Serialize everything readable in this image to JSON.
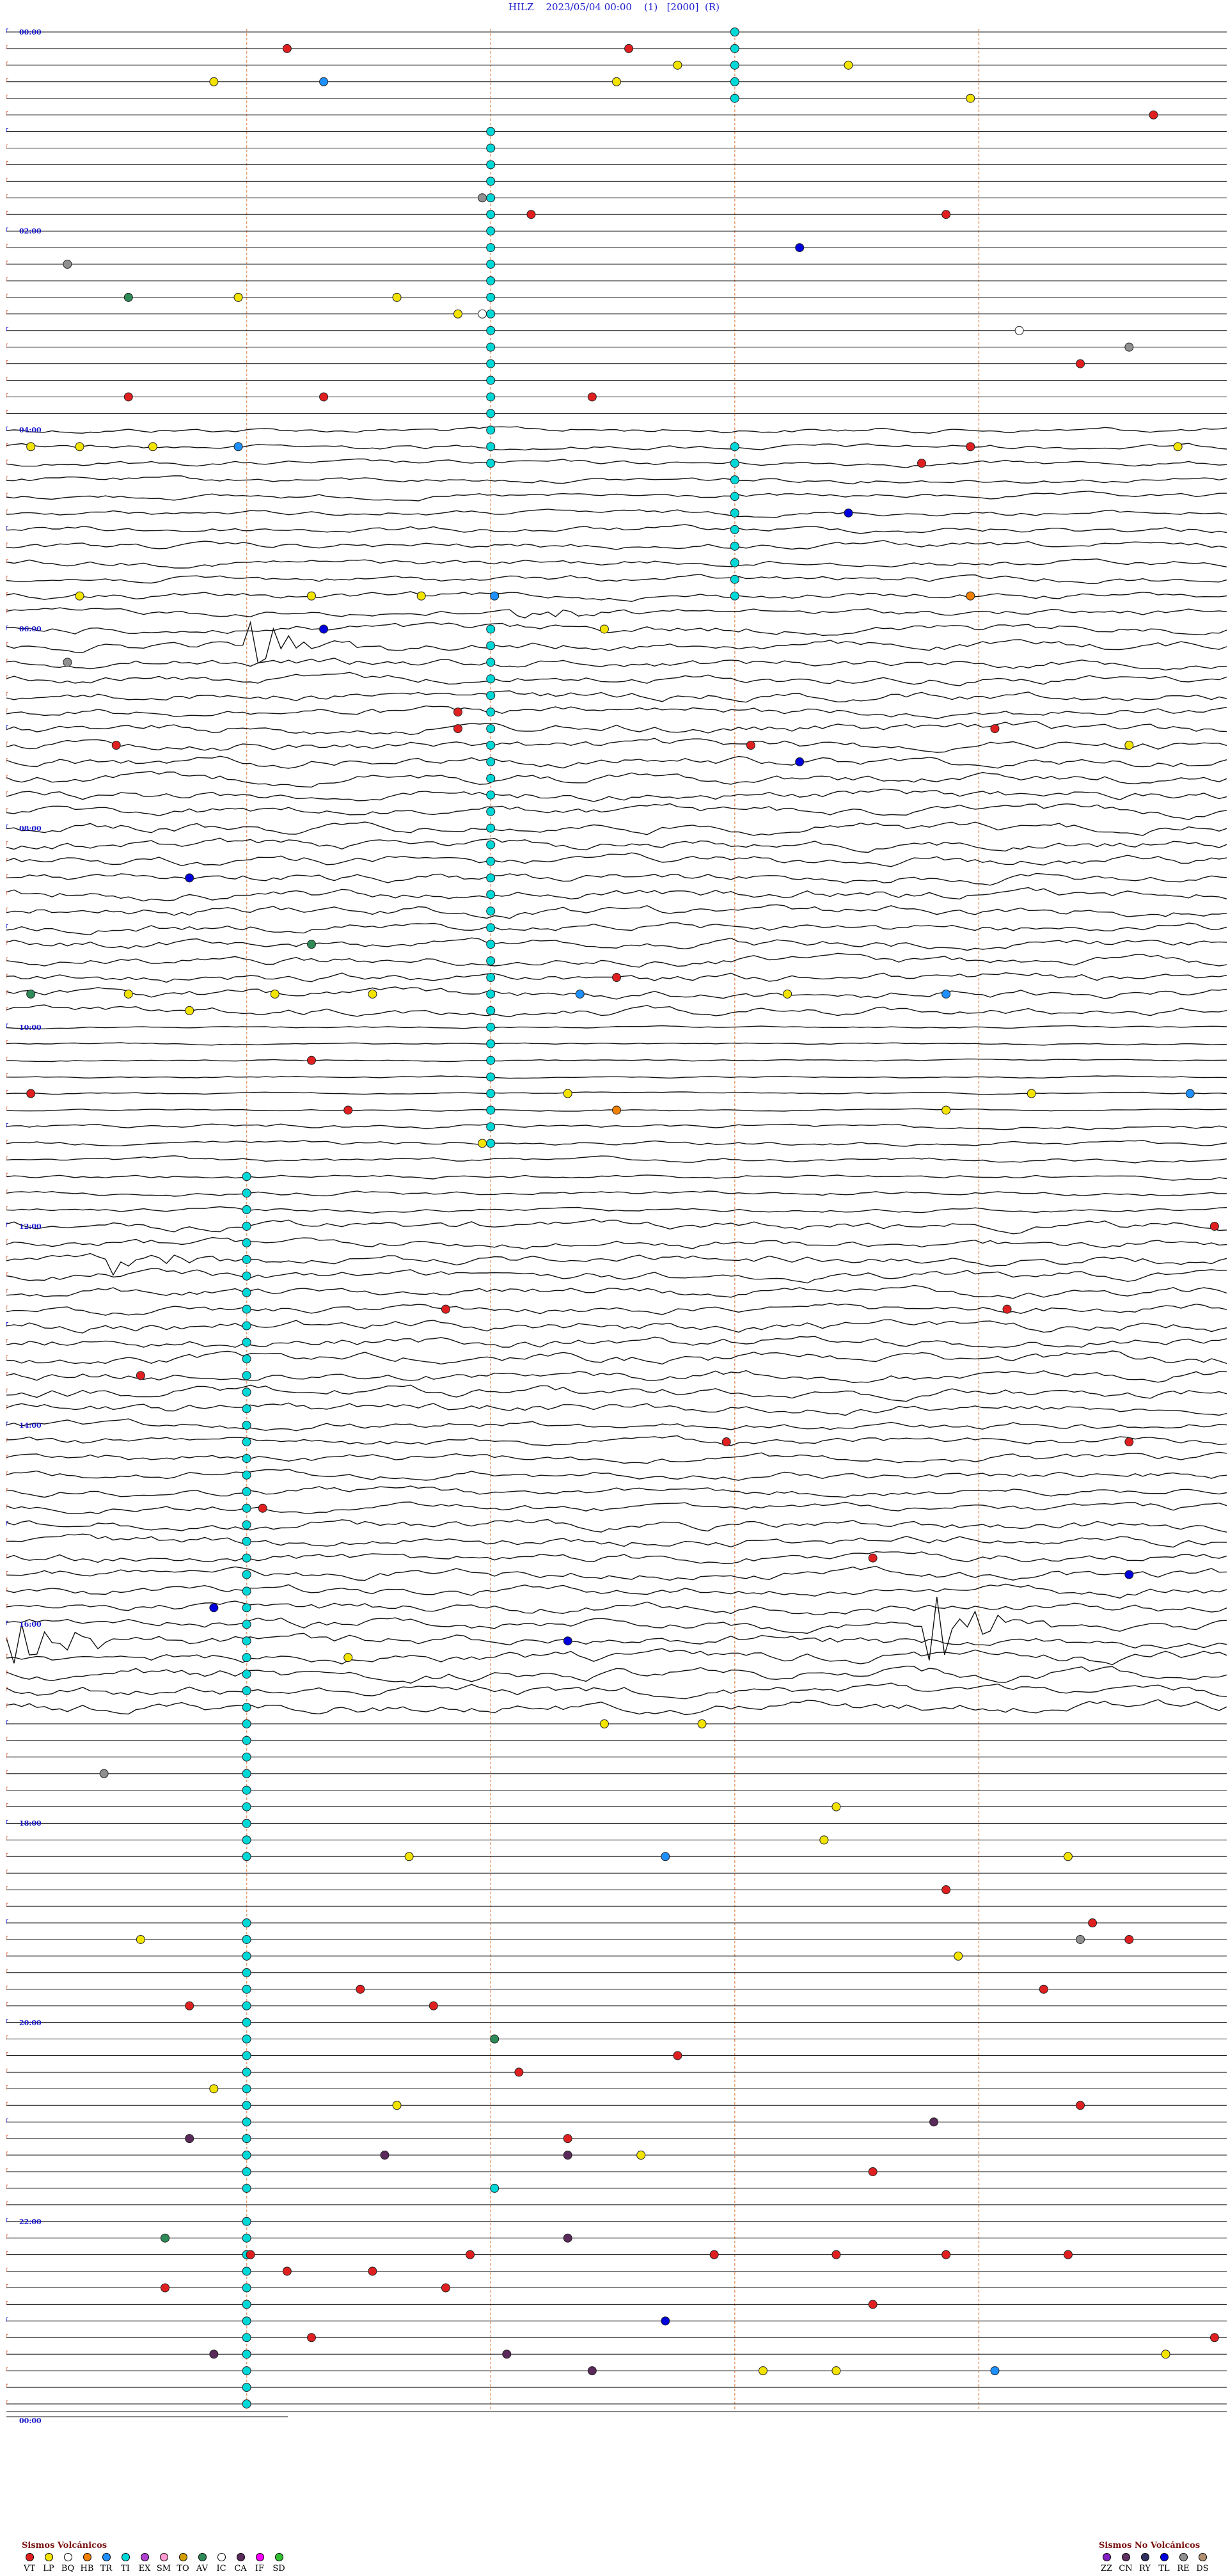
{
  "header": {
    "station": "HILZ",
    "datetime": "2023/05/04 00:00",
    "component": "(1)",
    "gain": "[2000]",
    "mode": "(R)"
  },
  "hour_labels": [
    "00:00",
    "02:00",
    "04:00",
    "06:00",
    "08:00",
    "10:00",
    "12:00",
    "14:00",
    "16:00",
    "18:00",
    "20:00",
    "22:00",
    "00:00"
  ],
  "legend_volcanic": {
    "title": "Sismos Volcánicos",
    "items": [
      {
        "code": "VT",
        "color": "#e02020"
      },
      {
        "code": "LP",
        "color": "#f2e400"
      },
      {
        "code": "BQ",
        "color": "#ffffff"
      },
      {
        "code": "HB",
        "color": "#f08000"
      },
      {
        "code": "TR",
        "color": "#1e90ff"
      },
      {
        "code": "TI",
        "color": "#00d8d8"
      },
      {
        "code": "EX",
        "color": "#b040d0"
      },
      {
        "code": "SM",
        "color": "#ff9ad0"
      },
      {
        "code": "TO",
        "color": "#d4a000"
      },
      {
        "code": "AV",
        "color": "#2e8b57"
      },
      {
        "code": "IC",
        "color": "#ffffff"
      },
      {
        "code": "CA",
        "color": "#5a2a5a"
      },
      {
        "code": "IF",
        "color": "#ff00ff"
      },
      {
        "code": "SD",
        "color": "#30c030"
      }
    ]
  },
  "legend_nonvolcanic": {
    "title": "Sismos No Volcánicos",
    "items": [
      {
        "code": "ZZ",
        "color": "#8020c0"
      },
      {
        "code": "CN",
        "color": "#603060"
      },
      {
        "code": "RY",
        "color": "#303060"
      },
      {
        "code": "TL",
        "color": "#0000dd"
      },
      {
        "code": "RE",
        "color": "#909090"
      },
      {
        "code": "DS",
        "color": "#b09070"
      }
    ]
  },
  "chart_data": {
    "type": "helicorder",
    "start": "2023/05/04 00:00",
    "end": "2023/05/05 00:00",
    "lines_per_hour": 6,
    "total_lines": 144,
    "minutes_per_line": 10,
    "noise_profile_by_hour": [
      0,
      0,
      0,
      0,
      1.2,
      1.5,
      2.0,
      2.2,
      2.2,
      2.0,
      0.4,
      1.0,
      2.0,
      2.3,
      1.8,
      2.2,
      2.5,
      0,
      0,
      0,
      0,
      0,
      0,
      0
    ],
    "bursts": [
      {
        "hour": 5,
        "minute_in_line": 4.2,
        "line_in_hour": 5,
        "amp": 4
      },
      {
        "hour": 6,
        "minute_in_line": 2.0,
        "line_in_hour": 1,
        "amp": 10
      },
      {
        "hour": 12,
        "minute_in_line": 0.9,
        "line_in_hour": 2,
        "amp": 6
      },
      {
        "hour": 16,
        "minute_in_line": 0.1,
        "line_in_hour": 1,
        "amp": 12
      },
      {
        "hour": 16,
        "minute_in_line": 7.6,
        "line_in_hour": 0,
        "amp": 14
      },
      {
        "hour": 20,
        "minute_in_line": 8.6,
        "line_in_hour": 0,
        "amp": 10
      }
    ],
    "ti_columns": [
      {
        "minute": 6.0,
        "from_hour": 0,
        "to_hour": 0.6
      },
      {
        "minute": 4.0,
        "from_hour": 1.0,
        "to_hour": 4.4
      },
      {
        "minute": 6.0,
        "from_hour": 4.1,
        "to_hour": 5.7
      },
      {
        "minute": 4.0,
        "from_hour": 6.0,
        "to_hour": 9.8
      },
      {
        "minute": 4.0,
        "from_hour": 10.0,
        "to_hour": 11.2
      },
      {
        "minute": 2.0,
        "from_hour": 11.5,
        "to_hour": 18.4
      },
      {
        "minute": 2.0,
        "from_hour": 19.0,
        "to_hour": 19.5
      },
      {
        "minute": 2.0,
        "from_hour": 19.6,
        "to_hour": 21.7
      },
      {
        "minute": 2.0,
        "from_hour": 22.0,
        "to_hour": 24.0
      }
    ],
    "events": [
      {
        "hour": 0.2,
        "minute": 2.3,
        "type": "VT"
      },
      {
        "hour": 0.5,
        "minute": 1.7,
        "type": "LP"
      },
      {
        "hour": 0.5,
        "minute": 2.6,
        "type": "TR"
      },
      {
        "hour": 0.4,
        "minute": 5.5,
        "type": "LP"
      },
      {
        "hour": 0.5,
        "minute": 5.0,
        "type": "LP"
      },
      {
        "hour": 0.1,
        "minute": 5.1,
        "type": "VT"
      },
      {
        "hour": 0.4,
        "minute": 6.9,
        "type": "LP"
      },
      {
        "hour": 0.6,
        "minute": 7.9,
        "type": "LP"
      },
      {
        "hour": 0.9,
        "minute": 9.4,
        "type": "VT"
      },
      {
        "hour": 1.6,
        "minute": 3.9,
        "type": "RE"
      },
      {
        "hour": 1.8,
        "minute": 4.3,
        "type": "VT"
      },
      {
        "hour": 2.1,
        "minute": 6.5,
        "type": "TL"
      },
      {
        "hour": 1.9,
        "minute": 7.7,
        "type": "VT"
      },
      {
        "hour": 2.4,
        "minute": 0.5,
        "type": "RE"
      },
      {
        "hour": 2.6,
        "minute": 1.0,
        "type": "AV"
      },
      {
        "hour": 2.7,
        "minute": 1.9,
        "type": "LP"
      },
      {
        "hour": 2.7,
        "minute": 3.2,
        "type": "LP"
      },
      {
        "hour": 2.9,
        "minute": 3.7,
        "type": "LP"
      },
      {
        "hour": 2.9,
        "minute": 3.9,
        "type": "BQ"
      },
      {
        "hour": 3.0,
        "minute": 8.3,
        "type": "BQ"
      },
      {
        "hour": 3.2,
        "minute": 9.2,
        "type": "RE"
      },
      {
        "hour": 3.3,
        "minute": 8.8,
        "type": "VT"
      },
      {
        "hour": 3.6,
        "minute": 2.6,
        "type": "VT"
      },
      {
        "hour": 3.7,
        "minute": 1.0,
        "type": "VT"
      },
      {
        "hour": 3.7,
        "minute": 4.8,
        "type": "VT"
      },
      {
        "hour": 4.1,
        "minute": 0.2,
        "type": "LP"
      },
      {
        "hour": 4.1,
        "minute": 0.6,
        "type": "LP"
      },
      {
        "hour": 4.1,
        "minute": 1.2,
        "type": "LP"
      },
      {
        "hour": 4.1,
        "minute": 1.9,
        "type": "TR"
      },
      {
        "hour": 4.1,
        "minute": 7.9,
        "type": "VT"
      },
      {
        "hour": 4.1,
        "minute": 9.6,
        "type": "LP"
      },
      {
        "hour": 4.3,
        "minute": 7.5,
        "type": "VT"
      },
      {
        "hour": 4.8,
        "minute": 6.9,
        "type": "TL"
      },
      {
        "hour": 5.6,
        "minute": 0.6,
        "type": "LP"
      },
      {
        "hour": 5.6,
        "minute": 2.5,
        "type": "LP"
      },
      {
        "hour": 5.6,
        "minute": 3.4,
        "type": "LP"
      },
      {
        "hour": 5.7,
        "minute": 4.0,
        "type": "TR"
      },
      {
        "hour": 5.6,
        "minute": 7.9,
        "type": "HB"
      },
      {
        "hour": 6.0,
        "minute": 4.9,
        "type": "LP"
      },
      {
        "hour": 6.0,
        "minute": 2.6,
        "type": "TL"
      },
      {
        "hour": 6.3,
        "minute": 0.5,
        "type": "RE"
      },
      {
        "hour": 6.8,
        "minute": 3.7,
        "type": "VT"
      },
      {
        "hour": 7.0,
        "minute": 3.7,
        "type": "VT"
      },
      {
        "hour": 7.2,
        "minute": 6.1,
        "type": "VT"
      },
      {
        "hour": 7.2,
        "minute": 0.9,
        "type": "VT"
      },
      {
        "hour": 7.3,
        "minute": 6.5,
        "type": "TL"
      },
      {
        "hour": 7.1,
        "minute": 9.2,
        "type": "LP"
      },
      {
        "hour": 7.0,
        "minute": 8.1,
        "type": "VT"
      },
      {
        "hour": 8.5,
        "minute": 1.5,
        "type": "TL"
      },
      {
        "hour": 9.2,
        "minute": 2.5,
        "type": "AV"
      },
      {
        "hour": 9.5,
        "minute": 5.0,
        "type": "VT"
      },
      {
        "hour": 9.6,
        "minute": 0.2,
        "type": "AV"
      },
      {
        "hour": 9.6,
        "minute": 1.0,
        "type": "LP"
      },
      {
        "hour": 9.6,
        "minute": 2.2,
        "type": "LP"
      },
      {
        "hour": 9.6,
        "minute": 3.0,
        "type": "LP"
      },
      {
        "hour": 9.6,
        "minute": 4.7,
        "type": "TR"
      },
      {
        "hour": 9.6,
        "minute": 7.7,
        "type": "TR"
      },
      {
        "hour": 9.6,
        "minute": 6.4,
        "type": "LP"
      },
      {
        "hour": 9.8,
        "minute": 1.5,
        "type": "LP"
      },
      {
        "hour": 10.3,
        "minute": 2.5,
        "type": "VT"
      },
      {
        "hour": 10.6,
        "minute": 0.2,
        "type": "VT"
      },
      {
        "hour": 10.7,
        "minute": 4.6,
        "type": "LP"
      },
      {
        "hour": 10.8,
        "minute": 5.0,
        "type": "HB"
      },
      {
        "hour": 10.9,
        "minute": 2.8,
        "type": "VT"
      },
      {
        "hour": 10.8,
        "minute": 7.7,
        "type": "LP"
      },
      {
        "hour": 10.7,
        "minute": 8.4,
        "type": "LP"
      },
      {
        "hour": 10.7,
        "minute": 9.7,
        "type": "TR"
      },
      {
        "hour": 11.1,
        "minute": 3.9,
        "type": "LP"
      },
      {
        "hour": 12.0,
        "minute": 9.9,
        "type": "VT"
      },
      {
        "hour": 12.8,
        "minute": 3.6,
        "type": "VT"
      },
      {
        "hour": 12.8,
        "minute": 8.2,
        "type": "VT"
      },
      {
        "hour": 13.5,
        "minute": 1.1,
        "type": "VT"
      },
      {
        "hour": 14.1,
        "minute": 5.9,
        "type": "VT"
      },
      {
        "hour": 14.2,
        "minute": 9.2,
        "type": "VT"
      },
      {
        "hour": 14.9,
        "minute": 2.1,
        "type": "VT"
      },
      {
        "hour": 15.3,
        "minute": 7.1,
        "type": "VT"
      },
      {
        "hour": 15.5,
        "minute": 9.2,
        "type": "TL"
      },
      {
        "hour": 15.9,
        "minute": 1.7,
        "type": "TL"
      },
      {
        "hour": 16.2,
        "minute": 4.6,
        "type": "TL"
      },
      {
        "hour": 16.4,
        "minute": 2.8,
        "type": "LP"
      },
      {
        "hour": 17.0,
        "minute": 4.9,
        "type": "LP"
      },
      {
        "hour": 17.0,
        "minute": 5.7,
        "type": "LP"
      },
      {
        "hour": 17.5,
        "minute": 0.8,
        "type": "RE"
      },
      {
        "hour": 17.8,
        "minute": 6.8,
        "type": "LP"
      },
      {
        "hour": 18.3,
        "minute": 5.4,
        "type": "TR"
      },
      {
        "hour": 18.1,
        "minute": 6.7,
        "type": "LP"
      },
      {
        "hour": 18.3,
        "minute": 3.3,
        "type": "LP"
      },
      {
        "hour": 18.4,
        "minute": 8.7,
        "type": "LP"
      },
      {
        "hour": 18.7,
        "minute": 7.7,
        "type": "VT"
      },
      {
        "hour": 19.0,
        "minute": 8.9,
        "type": "VT"
      },
      {
        "hour": 19.1,
        "minute": 1.1,
        "type": "LP"
      },
      {
        "hour": 19.1,
        "minute": 9.2,
        "type": "VT"
      },
      {
        "hour": 19.2,
        "minute": 8.8,
        "type": "RE"
      },
      {
        "hour": 19.3,
        "minute": 7.8,
        "type": "LP"
      },
      {
        "hour": 19.6,
        "minute": 2.9,
        "type": "VT"
      },
      {
        "hour": 19.6,
        "minute": 8.5,
        "type": "VT"
      },
      {
        "hour": 19.8,
        "minute": 3.5,
        "type": "VT"
      },
      {
        "hour": 19.9,
        "minute": 1.5,
        "type": "VT"
      },
      {
        "hour": 20.2,
        "minute": 4.0,
        "type": "AV"
      },
      {
        "hour": 20.4,
        "minute": 5.5,
        "type": "VT"
      },
      {
        "hour": 20.5,
        "minute": 4.2,
        "type": "VT"
      },
      {
        "hour": 20.7,
        "minute": 1.7,
        "type": "LP"
      },
      {
        "hour": 20.8,
        "minute": 3.2,
        "type": "LP"
      },
      {
        "hour": 20.8,
        "minute": 8.8,
        "type": "VT"
      },
      {
        "hour": 21.0,
        "minute": 7.6,
        "type": "CA"
      },
      {
        "hour": 21.1,
        "minute": 1.5,
        "type": "CA"
      },
      {
        "hour": 21.2,
        "minute": 4.6,
        "type": "VT"
      },
      {
        "hour": 21.3,
        "minute": 5.2,
        "type": "LP"
      },
      {
        "hour": 21.4,
        "minute": 3.1,
        "type": "CA"
      },
      {
        "hour": 21.4,
        "minute": 4.6,
        "type": "CA"
      },
      {
        "hour": 21.5,
        "minute": 7.1,
        "type": "VT"
      },
      {
        "hour": 21.7,
        "minute": 4.0,
        "type": "TI"
      },
      {
        "hour": 22.1,
        "minute": 4.6,
        "type": "CA"
      },
      {
        "hour": 22.2,
        "minute": 1.3,
        "type": "AV"
      },
      {
        "hour": 22.3,
        "minute": 3.8,
        "type": "VT"
      },
      {
        "hour": 22.4,
        "minute": 2.0,
        "type": "VT"
      },
      {
        "hour": 22.4,
        "minute": 5.8,
        "type": "VT"
      },
      {
        "hour": 22.4,
        "minute": 6.8,
        "type": "VT"
      },
      {
        "hour": 22.4,
        "minute": 7.7,
        "type": "VT"
      },
      {
        "hour": 22.4,
        "minute": 8.7,
        "type": "VT"
      },
      {
        "hour": 22.5,
        "minute": 2.3,
        "type": "VT"
      },
      {
        "hour": 22.5,
        "minute": 3.0,
        "type": "VT"
      },
      {
        "hour": 22.7,
        "minute": 1.3,
        "type": "VT"
      },
      {
        "hour": 22.7,
        "minute": 3.6,
        "type": "VT"
      },
      {
        "hour": 22.8,
        "minute": 7.1,
        "type": "VT"
      },
      {
        "hour": 23.0,
        "minute": 5.4,
        "type": "TL"
      },
      {
        "hour": 23.1,
        "minute": 2.5,
        "type": "VT"
      },
      {
        "hour": 23.3,
        "minute": 1.7,
        "type": "CA"
      },
      {
        "hour": 23.3,
        "minute": 4.1,
        "type": "CA"
      },
      {
        "hour": 23.4,
        "minute": 9.5,
        "type": "LP"
      },
      {
        "hour": 23.5,
        "minute": 6.2,
        "type": "LP"
      },
      {
        "hour": 23.5,
        "minute": 6.8,
        "type": "LP"
      },
      {
        "hour": 23.5,
        "minute": 8.1,
        "type": "TR"
      },
      {
        "hour": 23.5,
        "minute": 4.8,
        "type": "CA"
      },
      {
        "hour": 23.2,
        "minute": 9.9,
        "type": "VT"
      }
    ]
  }
}
